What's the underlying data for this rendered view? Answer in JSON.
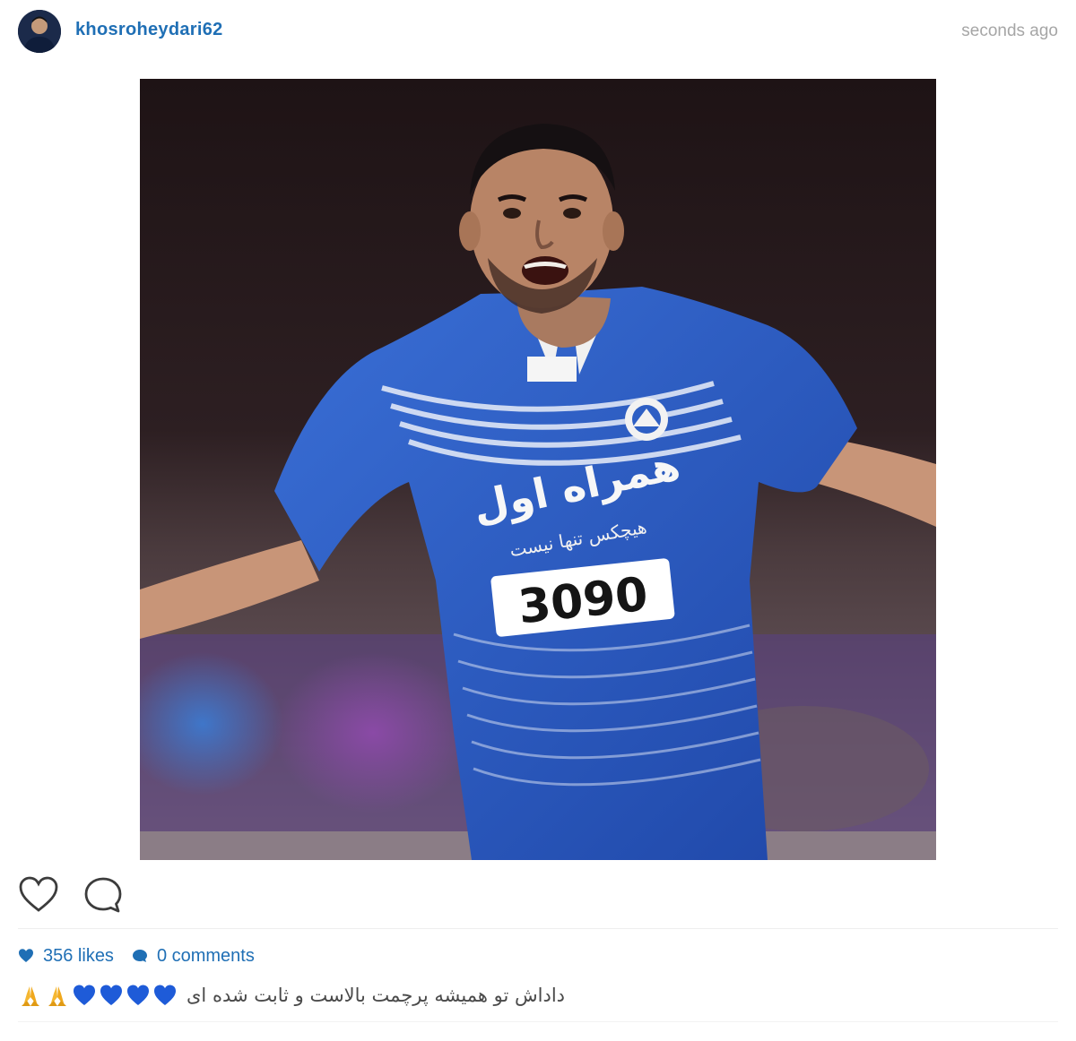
{
  "post": {
    "username": "khosroheydari62",
    "timestamp": "seconds ago",
    "avatar_icon": "profile-avatar",
    "photo": {
      "jersey_number": "3090",
      "jersey_sponsor": "همراه اول",
      "jersey_tagline": "هیچکس تنها نیست"
    },
    "actions": {
      "like_icon": "heart-outline-icon",
      "comment_icon": "comment-bubble-icon"
    },
    "stats": {
      "likes": "356 likes",
      "comments": "0 comments"
    },
    "caption": {
      "text": "داداش تو همیشه پرچمت بالاست و ثابت شده ای",
      "emojis": [
        "folded-hands",
        "folded-hands",
        "blue-heart",
        "blue-heart",
        "blue-heart",
        "blue-heart"
      ]
    }
  },
  "colors": {
    "accent": "#1f6fb5",
    "timestamp": "#a6a6a6",
    "heart_blue": "#1e5bd8",
    "jersey_blue": "#2e5fc4"
  }
}
